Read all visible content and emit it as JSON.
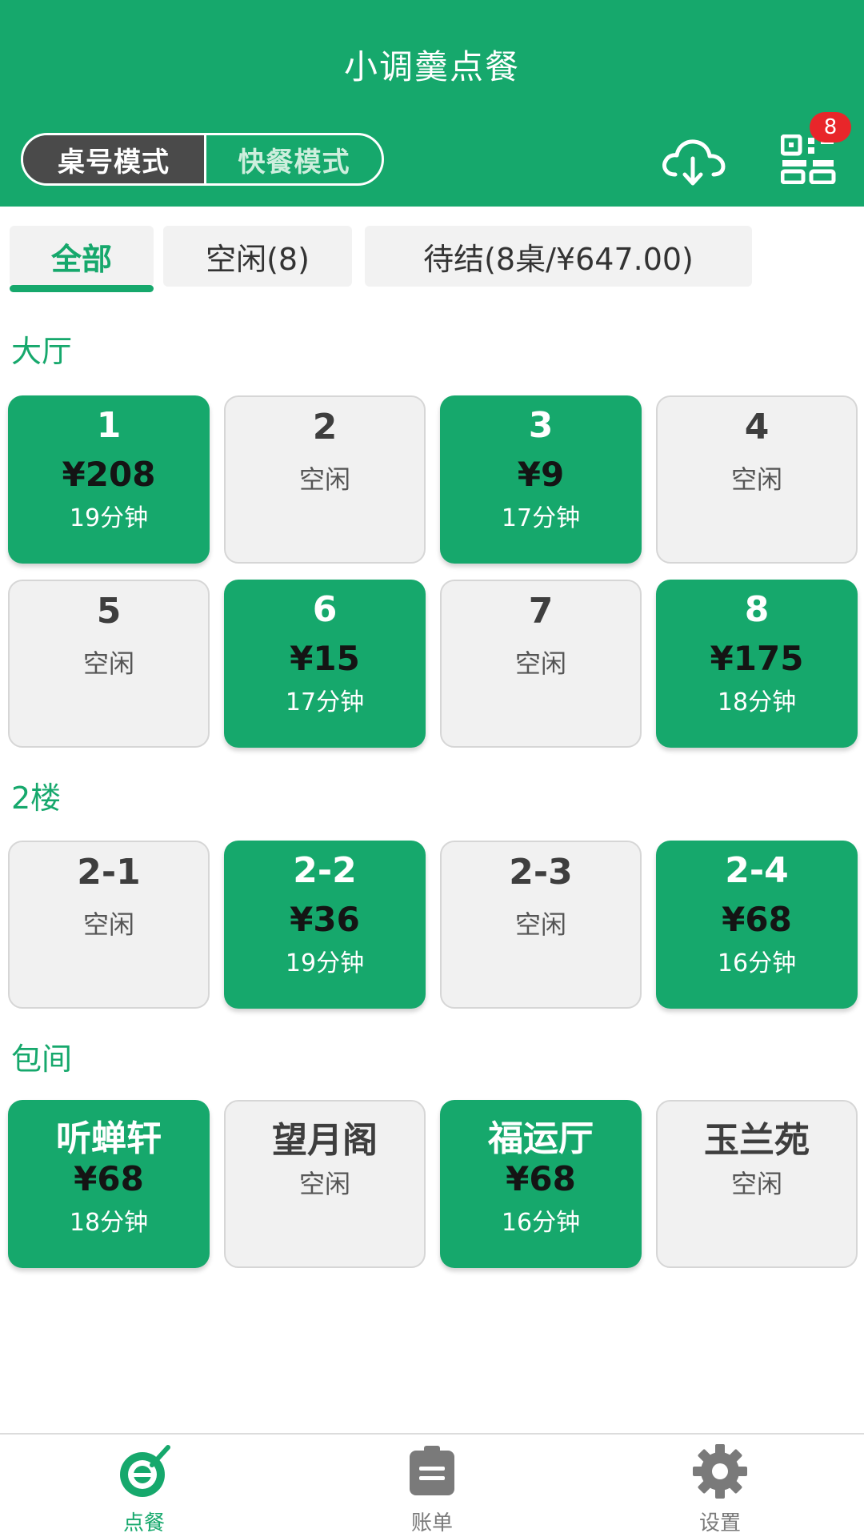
{
  "header": {
    "title": "小调羹点餐",
    "mode_active": "桌号模式",
    "mode_inactive": "快餐模式",
    "qr_badge": "8",
    "accent_color": "#16a86c",
    "icons": [
      "cloud-download-icon",
      "qr-code-icon"
    ]
  },
  "tabs": [
    {
      "label": "全部",
      "active": true
    },
    {
      "label": "空闲(8)",
      "active": false
    },
    {
      "label": "待结(8桌/¥647.00)",
      "active": false
    }
  ],
  "sections": [
    {
      "title": "大厅",
      "tables": [
        {
          "name": "1",
          "amount": "¥208",
          "time": "19分钟"
        },
        {
          "name": "2",
          "status": "空闲"
        },
        {
          "name": "3",
          "amount": "¥9",
          "time": "17分钟"
        },
        {
          "name": "4",
          "status": "空闲"
        },
        {
          "name": "5",
          "status": "空闲"
        },
        {
          "name": "6",
          "amount": "¥15",
          "time": "17分钟"
        },
        {
          "name": "7",
          "status": "空闲"
        },
        {
          "name": "8",
          "amount": "¥175",
          "time": "18分钟"
        }
      ]
    },
    {
      "title": "2楼",
      "tables": [
        {
          "name": "2-1",
          "status": "空闲"
        },
        {
          "name": "2-2",
          "amount": "¥36",
          "time": "19分钟"
        },
        {
          "name": "2-3",
          "status": "空闲"
        },
        {
          "name": "2-4",
          "amount": "¥68",
          "time": "16分钟"
        }
      ]
    },
    {
      "title": "包间",
      "tables": [
        {
          "name": "听蝉轩",
          "amount": "¥68",
          "time": "18分钟"
        },
        {
          "name": "望月阁",
          "status": "空闲"
        },
        {
          "name": "福运厅",
          "amount": "¥68",
          "time": "16分钟"
        },
        {
          "name": "玉兰苑",
          "status": "空闲"
        }
      ]
    }
  ],
  "nav": [
    {
      "label": "点餐",
      "icon": "order-food-icon",
      "active": true
    },
    {
      "label": "账单",
      "icon": "bill-icon",
      "active": false
    },
    {
      "label": "设置",
      "icon": "gear-icon",
      "active": false
    }
  ]
}
